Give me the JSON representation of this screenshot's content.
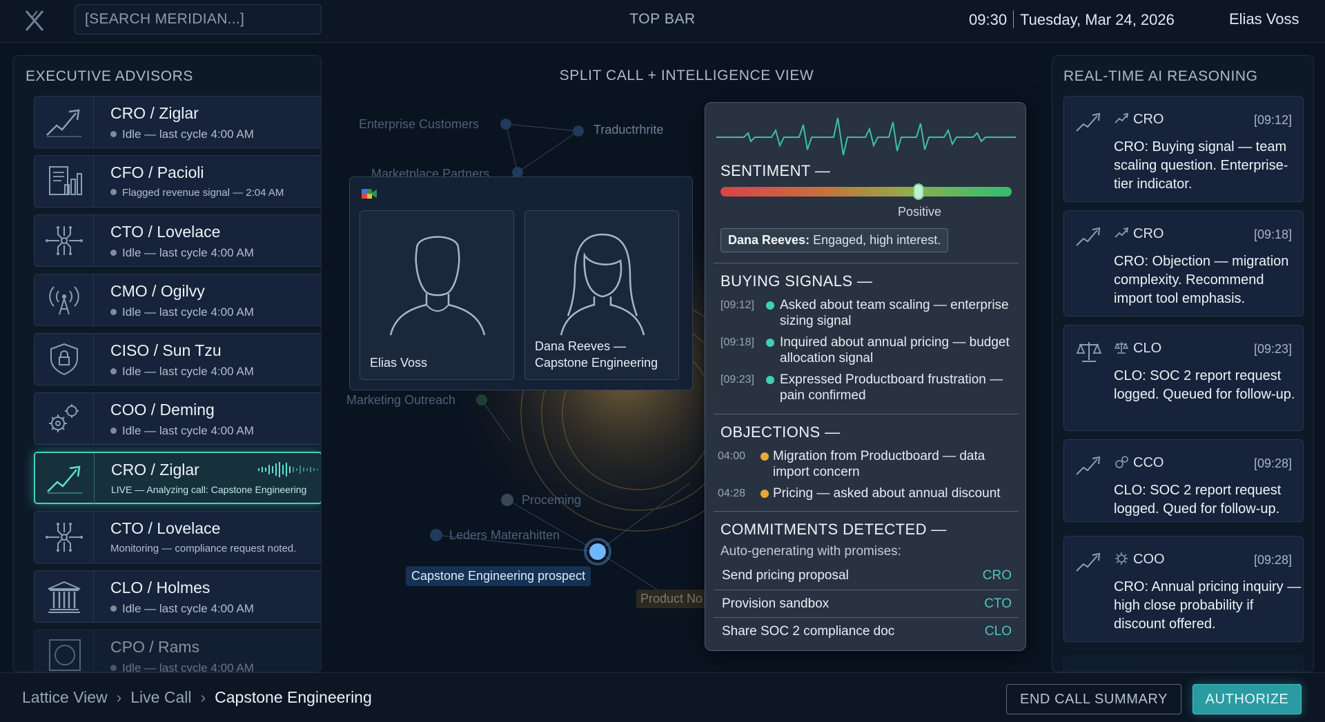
{
  "topbar": {
    "search_placeholder": "[SEARCH MERIDIAN...]",
    "center_label": "TOP BAR",
    "time": "09:30",
    "date": "Tuesday, Mar 24, 2026",
    "user": "Elias Voss"
  },
  "advisors": {
    "title": "EXECUTIVE ADVISORS",
    "items": [
      {
        "name": "CRO / Ziglar",
        "status": "Idle — last cycle 4:00 AM",
        "icon": "trend-up-icon"
      },
      {
        "name": "CFO / Pacioli",
        "status": "Flagged revenue signal — 2:04 AM",
        "icon": "ledger-chart-icon"
      },
      {
        "name": "CTO / Lovelace",
        "status": "Idle — last cycle 4:00 AM",
        "icon": "circuit-icon"
      },
      {
        "name": "CMO / Ogilvy",
        "status": "Idle — last cycle 4:00 AM",
        "icon": "broadcast-icon"
      },
      {
        "name": "CISO / Sun Tzu",
        "status": "Idle — last cycle 4:00 AM",
        "icon": "shield-lock-icon"
      },
      {
        "name": "COO / Deming",
        "status": "Idle — last cycle 4:00 AM",
        "icon": "gears-icon"
      },
      {
        "name": "CRO / Ziglar",
        "status": "LIVE — Analyzing call: Capstone Engineering",
        "icon": "trend-up-icon"
      },
      {
        "name": "CTO / Lovelace",
        "status": "Monitoring — compliance request noted.",
        "icon": "circuit-icon"
      },
      {
        "name": "CLO / Holmes",
        "status": "Idle — last cycle 4:00 AM",
        "icon": "courthouse-icon"
      },
      {
        "name": "CPO / Rams",
        "status": "Idle — last cycle 4:00 AM",
        "icon": "circle-square-icon"
      }
    ]
  },
  "center": {
    "title": "SPLIT CALL + INTELLIGENCE VIEW",
    "graph_labels": {
      "enterprise": "Enterprise Customers",
      "traduct": "Traductrhrite",
      "marketplace": "Marketplace Partners",
      "marketing": "Marketing Outreach",
      "proceming": "Proceming",
      "leders": "Leders Materahitten",
      "prospect": "Capstone Engineering prospect",
      "product": "Product No"
    }
  },
  "call": {
    "participants": [
      {
        "name": "Elias Voss"
      },
      {
        "name": "Dana Reeves —",
        "org": "Capstone Engineering"
      }
    ]
  },
  "intel": {
    "sentiment": {
      "title": "SENTIMENT —",
      "level": 0.68,
      "label": "Positive",
      "speaker": "Dana Reeves:",
      "note": "Engaged, high interest."
    },
    "buying_signals": {
      "title": "BUYING SIGNALS —",
      "items": [
        {
          "time": "[09:12]",
          "text": "Asked about team scaling — enterprise sizing signal"
        },
        {
          "time": "[09:18]",
          "text": "Inquired about annual pricing — budget allocation signal"
        },
        {
          "time": "[09:23]",
          "text": "Expressed Productboard frustration — pain confirmed"
        }
      ]
    },
    "objections": {
      "title": "OBJECTIONS —",
      "items": [
        {
          "time": "04:00",
          "text": "Migration from Productboard — data import concern"
        },
        {
          "time": "04:28",
          "text": "Pricing — asked about annual discount"
        }
      ]
    },
    "commitments": {
      "title": "COMMITMENTS DETECTED —",
      "subtitle": "Auto-generating with promises:",
      "items": [
        {
          "text": "Send pricing proposal",
          "owner": "CRO"
        },
        {
          "text": "Provision sandbox",
          "owner": "CTO"
        },
        {
          "text": "Share SOC 2 compliance doc",
          "owner": "CLO"
        }
      ]
    },
    "colors": {
      "signal": "#3fd0b8",
      "objection": "#e8a838",
      "owner": "#4fc6bf"
    }
  },
  "reasoning": {
    "title": "REAL-TIME AI REASONING",
    "items": [
      {
        "agent": "CRO",
        "time": "[09:12]",
        "message": "CRO: Buying signal — team scaling question. Enterprise-tier indicator.",
        "icon": "trend-up-icon"
      },
      {
        "agent": "CRO",
        "time": "[09:18]",
        "message": "CRO: Objection — migration complexity. Recommend import tool emphasis.",
        "icon": "trend-up-icon"
      },
      {
        "agent": "CLO",
        "time": "[09:23]",
        "message": "CLO: SOC 2 report request logged. Queued for follow-up.",
        "icon": "scales-icon"
      },
      {
        "agent": "CCO",
        "time": "[09:28]",
        "message": "CLO: SOC 2 report request logged. Qued for follow-up.",
        "icon": "trend-up-icon"
      },
      {
        "agent": "COO",
        "time": "[09:28]",
        "message": "CRO: Annual pricing inquiry — high close probability if discount offered.",
        "icon": "trend-up-icon"
      }
    ]
  },
  "bottombar": {
    "breadcrumb": [
      "Lattice View",
      "Live Call",
      "Capstone Engineering"
    ],
    "end_call_label": "END CALL SUMMARY",
    "authorize_label": "AUTHORIZE"
  }
}
